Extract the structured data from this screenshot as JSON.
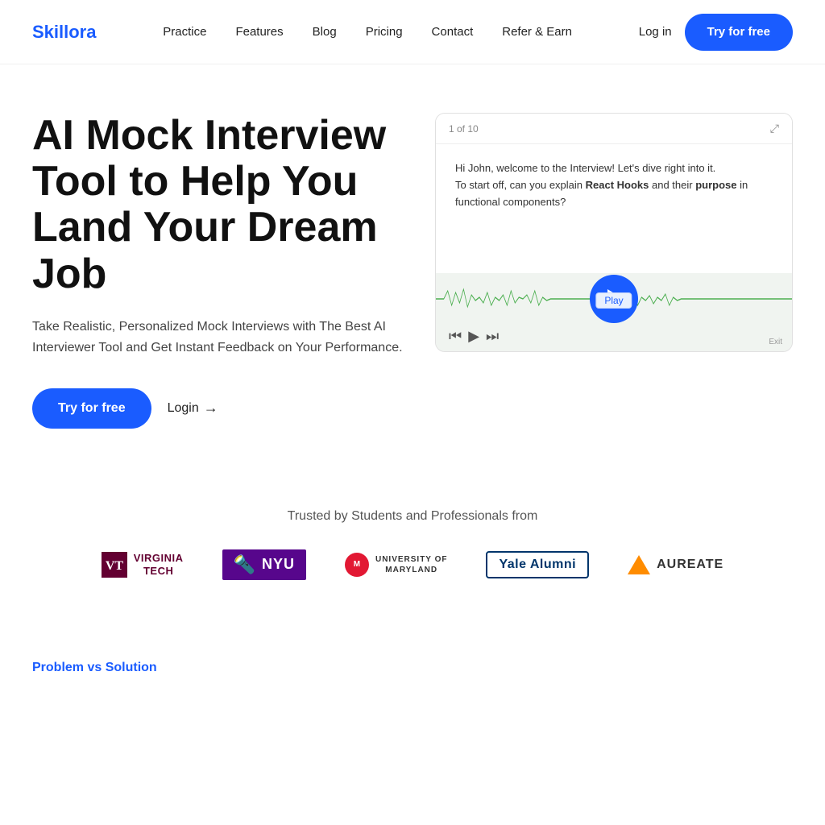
{
  "nav": {
    "logo": "Skillora",
    "links": [
      {
        "label": "Practice",
        "href": "#"
      },
      {
        "label": "Features",
        "href": "#"
      },
      {
        "label": "Blog",
        "href": "#"
      },
      {
        "label": "Pricing",
        "href": "#"
      },
      {
        "label": "Contact",
        "href": "#"
      },
      {
        "label": "Refer & Earn",
        "href": "#"
      }
    ],
    "login_label": "Log in",
    "cta_label": "Try for free"
  },
  "hero": {
    "title": "AI Mock Interview Tool to Help You Land Your Dream Job",
    "description": "Take Realistic, Personalized Mock Interviews with The Best AI Interviewer Tool and Get Instant Feedback on Your Performance.",
    "cta_label": "Try for free",
    "login_label": "Login",
    "video": {
      "counter": "1 of 10",
      "question_line1": "Hi John, welcome to the Interview! Let's dive right into it.",
      "question_line2": "To start off, can you explain ",
      "question_bold": "React Hooks",
      "question_line3": " and their ",
      "question_bold2": "purpose",
      "question_line4": " in functional components?",
      "play_label": "Play"
    }
  },
  "trusted": {
    "text": "Trusted by Students and Professionals from",
    "logos": [
      {
        "id": "virginia-tech",
        "name": "Virginia Tech"
      },
      {
        "id": "nyu",
        "name": "NYU"
      },
      {
        "id": "maryland",
        "name": "University of Maryland"
      },
      {
        "id": "yale",
        "name": "Yale Alumni"
      },
      {
        "id": "aureate",
        "name": "Aureate"
      }
    ]
  },
  "bottom": {
    "section_label": "Problem vs Solution"
  }
}
